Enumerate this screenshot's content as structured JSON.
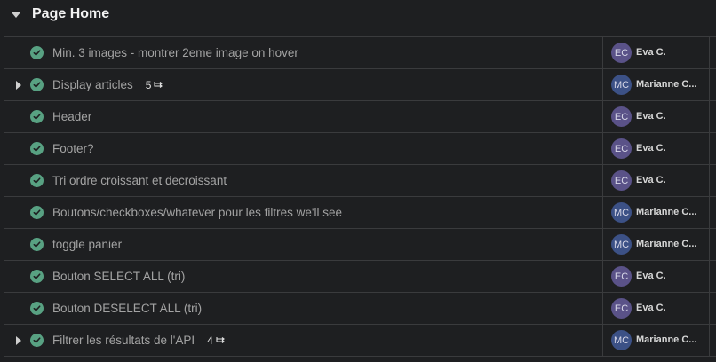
{
  "section": {
    "title": "Page Home"
  },
  "tasks": [
    {
      "name": "Min. 3 images - montrer 2eme image on hover",
      "has_subtasks": false,
      "subtask_count": "",
      "assignee_initials": "EC",
      "assignee_name": "Eva C.",
      "avatar_style": "ec"
    },
    {
      "name": "Display articles",
      "has_subtasks": true,
      "subtask_count": "5",
      "assignee_initials": "MC",
      "assignee_name": "Marianne C...",
      "avatar_style": "mc"
    },
    {
      "name": "Header",
      "has_subtasks": false,
      "subtask_count": "",
      "assignee_initials": "EC",
      "assignee_name": "Eva C.",
      "avatar_style": "ec"
    },
    {
      "name": "Footer?",
      "has_subtasks": false,
      "subtask_count": "",
      "assignee_initials": "EC",
      "assignee_name": "Eva C.",
      "avatar_style": "ec"
    },
    {
      "name": "Tri ordre croissant et decroissant",
      "has_subtasks": false,
      "subtask_count": "",
      "assignee_initials": "EC",
      "assignee_name": "Eva C.",
      "avatar_style": "ec"
    },
    {
      "name": "Boutons/checkboxes/whatever pour les filtres we'll see",
      "has_subtasks": false,
      "subtask_count": "",
      "assignee_initials": "MC",
      "assignee_name": "Marianne C...",
      "avatar_style": "mc"
    },
    {
      "name": "toggle panier",
      "has_subtasks": false,
      "subtask_count": "",
      "assignee_initials": "MC",
      "assignee_name": "Marianne C...",
      "avatar_style": "mc"
    },
    {
      "name": "Bouton SELECT ALL (tri)",
      "has_subtasks": false,
      "subtask_count": "",
      "assignee_initials": "EC",
      "assignee_name": "Eva C.",
      "avatar_style": "ec"
    },
    {
      "name": "Bouton DESELECT ALL (tri)",
      "has_subtasks": false,
      "subtask_count": "",
      "assignee_initials": "EC",
      "assignee_name": "Eva C.",
      "avatar_style": "ec"
    },
    {
      "name": "Filtrer les résultats de l'API",
      "has_subtasks": true,
      "subtask_count": "4",
      "assignee_initials": "MC",
      "assignee_name": "Marianne C...",
      "avatar_style": "mc"
    }
  ],
  "colors": {
    "background": "#1e1f21",
    "complete_check": "#58a182",
    "avatar_ec": "#5a5288",
    "avatar_mc": "#3c5186"
  },
  "icons": {
    "section_toggle": "caret-down-icon",
    "row_expand": "caret-right-icon",
    "complete": "check-circle-icon",
    "subtasks": "subtask-icon"
  }
}
